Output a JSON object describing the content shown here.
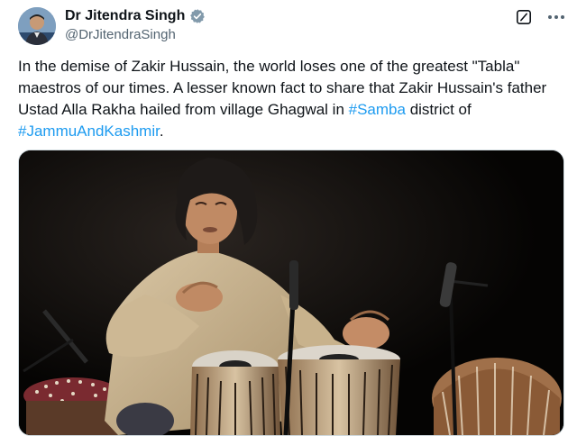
{
  "author": {
    "display_name": "Dr Jitendra Singh",
    "handle": "@DrJitendraSingh",
    "avatar_icon": "user-avatar",
    "verified_icon": "verified-badge-icon"
  },
  "actions": {
    "grok_icon": "grok-icon",
    "more_icon": "more-icon"
  },
  "tweet": {
    "text_part1": "In the demise of Zakir Hussain, the world loses one of the greatest \"Tabla\" maestros of our times. A lesser known fact to share that Zakir Hussain's father Ustad Alla Rakha hailed from village Ghagwal in ",
    "hashtag1": "#Samba",
    "text_part2": " district of ",
    "hashtag2": "#JammuAndKashmir",
    "text_part3": "."
  },
  "colors": {
    "link": "#1d9bf0",
    "verified": "#829aab",
    "text": "#0f1419",
    "secondary": "#536471"
  }
}
